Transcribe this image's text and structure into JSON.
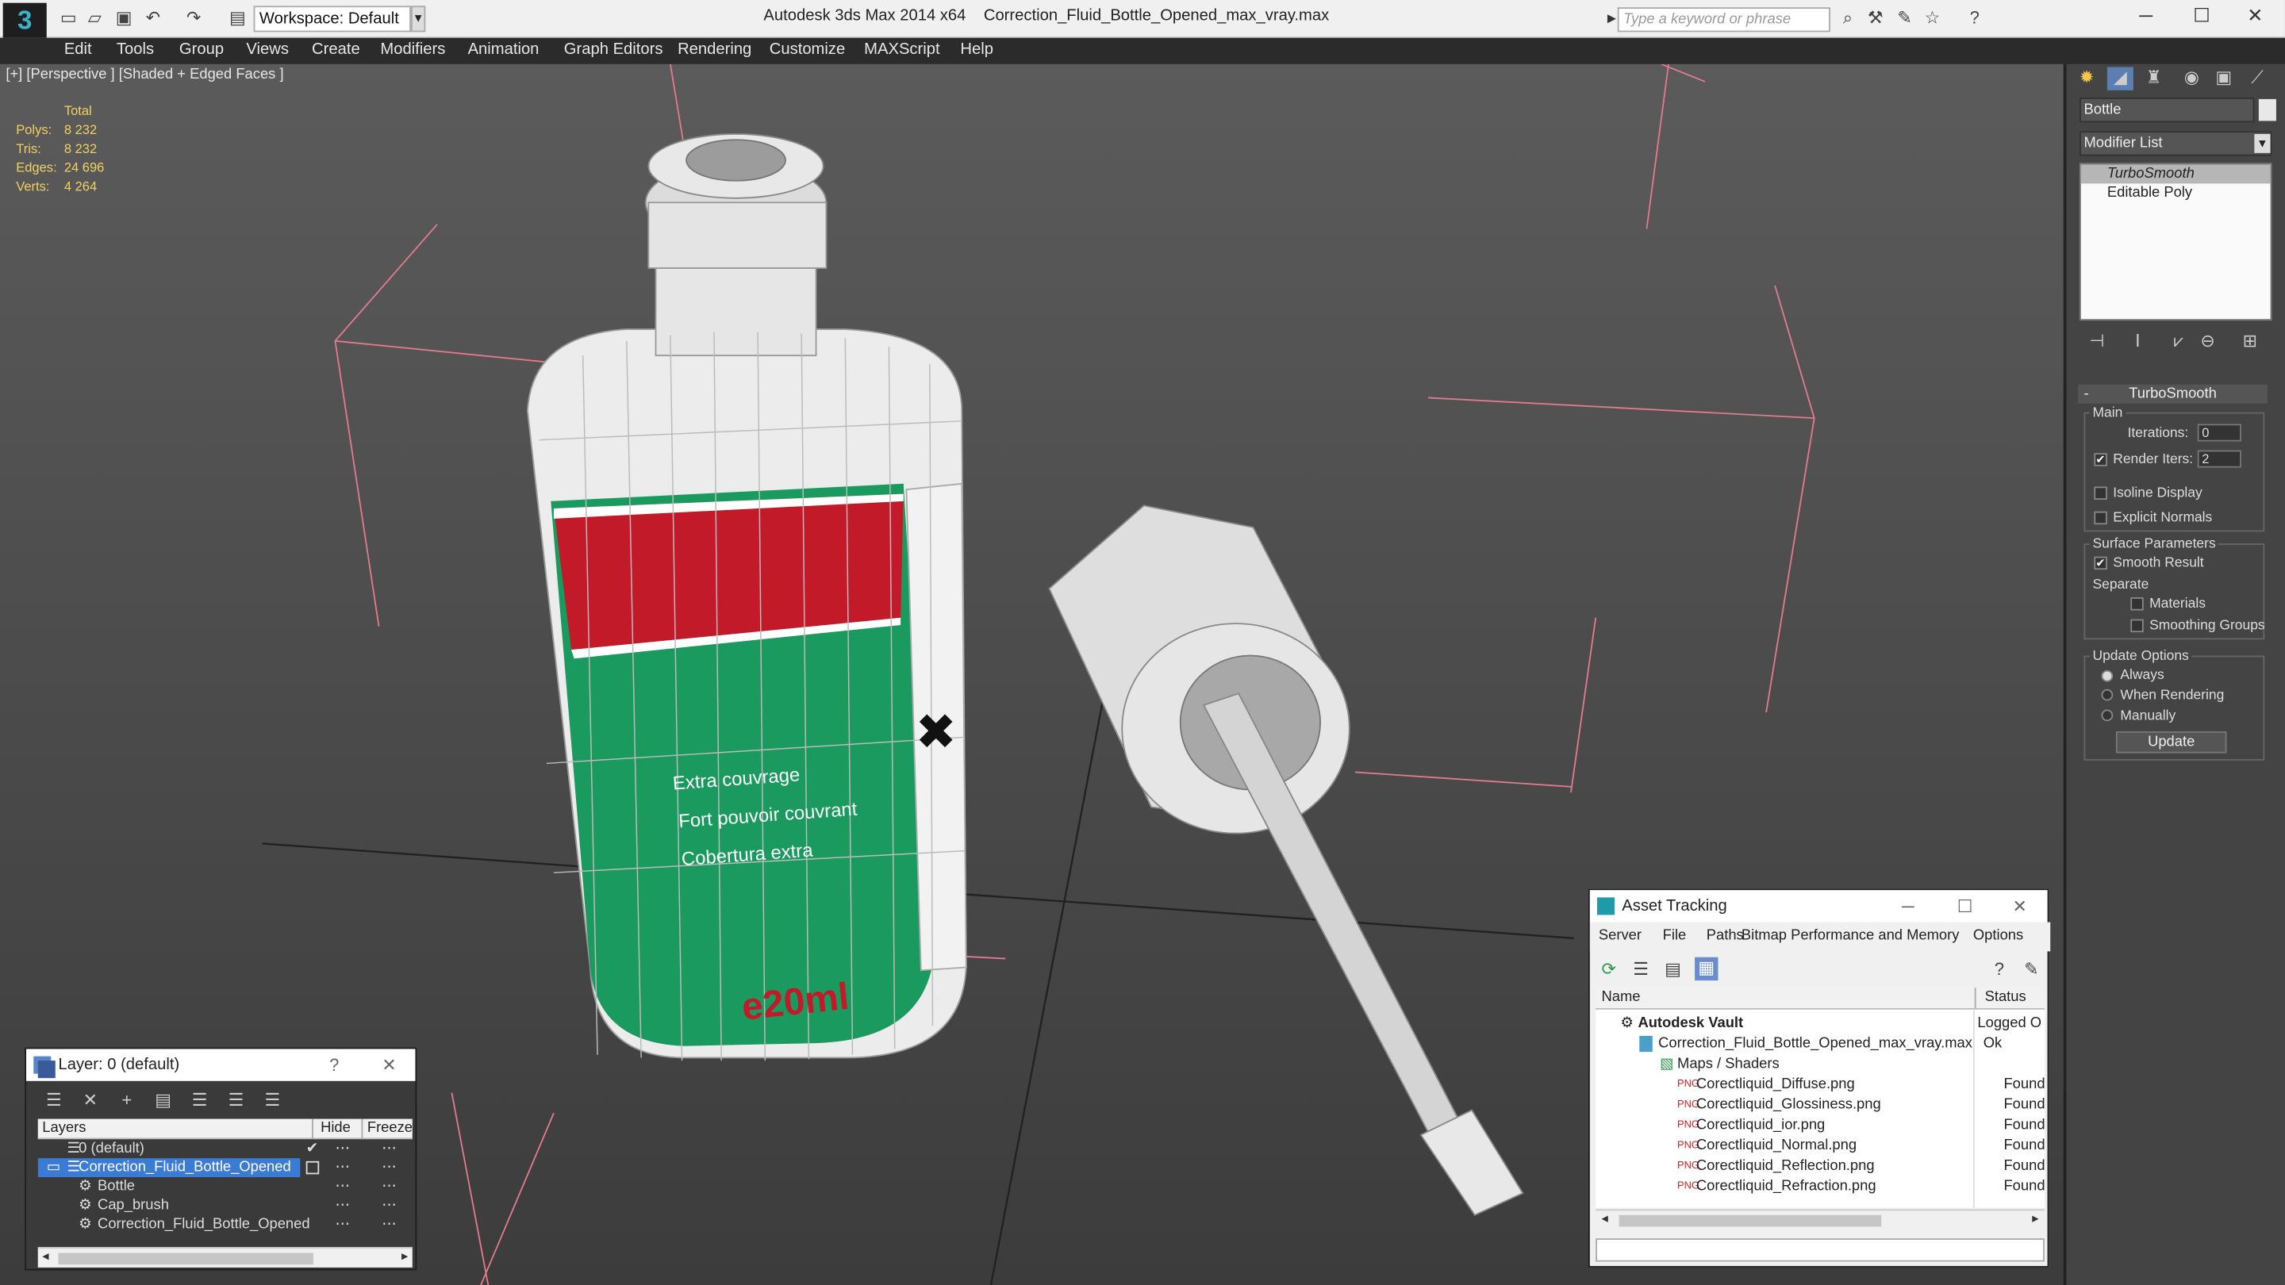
{
  "app": {
    "title": "Autodesk 3ds Max 2014 x64",
    "filename": "Correction_Fluid_Bottle_Opened_max_vray.max",
    "workspace": "Workspace: Default",
    "search_placeholder": "Type a keyword or phrase",
    "logo": "3"
  },
  "menu": [
    "Edit",
    "Tools",
    "Group",
    "Views",
    "Create",
    "Modifiers",
    "Animation",
    "Graph Editors",
    "Rendering",
    "Customize",
    "MAXScript",
    "Help"
  ],
  "viewport": {
    "label": "[+] [Perspective ] [Shaded + Edged Faces ]",
    "stats": {
      "header": "Total",
      "rows": [
        {
          "label": "Polys:",
          "value": "8 232"
        },
        {
          "label": "Tris:",
          "value": "8 232"
        },
        {
          "label": "Edges:",
          "value": "24 696"
        },
        {
          "label": "Verts:",
          "value": "4 264"
        }
      ]
    },
    "bottle_text": {
      "line1": "Extra couvrage",
      "line2": "Fort pouvoir couvrant",
      "line3": "Cobertura extra",
      "volume": "e20ml"
    }
  },
  "command_panel": {
    "object_name": "Bottle",
    "modifier_list": "Modifier List",
    "stack": [
      "TurboSmooth",
      "Editable Poly"
    ],
    "rollout_title": "TurboSmooth",
    "main_group": "Main",
    "iterations_label": "Iterations:",
    "iterations_value": "0",
    "render_iters_label": "Render Iters:",
    "render_iters_value": "2",
    "isoline": "Isoline Display",
    "explicit_normals": "Explicit Normals",
    "surface_params": "Surface Parameters",
    "smooth_result": "Smooth Result",
    "separate": "Separate",
    "materials": "Materials",
    "smoothing_groups": "Smoothing Groups",
    "update_options": "Update Options",
    "always": "Always",
    "when_rendering": "When Rendering",
    "manually": "Manually",
    "update_button": "Update"
  },
  "layer_window": {
    "title": "Layer: 0 (default)",
    "help": "?",
    "col_layers": "Layers",
    "col_hide": "Hide",
    "col_freeze": "Freeze",
    "rows": [
      {
        "name": "0 (default)",
        "indent": 1,
        "selected": false
      },
      {
        "name": "Correction_Fluid_Bottle_Opened",
        "indent": 1,
        "selected": true
      },
      {
        "name": "Bottle",
        "indent": 2,
        "selected": false
      },
      {
        "name": "Cap_brush",
        "indent": 2,
        "selected": false
      },
      {
        "name": "Correction_Fluid_Bottle_Opened",
        "indent": 2,
        "selected": false
      }
    ]
  },
  "asset_window": {
    "title": "Asset Tracking",
    "menu": [
      "Server",
      "File",
      "Paths",
      "Bitmap Performance and Memory",
      "Options"
    ],
    "col_name": "Name",
    "col_status": "Status",
    "rows": [
      {
        "name": "Autodesk Vault",
        "status": "Logged O",
        "indent": 1
      },
      {
        "name": "Correction_Fluid_Bottle_Opened_max_vray.max",
        "status": "Ok",
        "indent": 2
      },
      {
        "name": "Maps / Shaders",
        "status": "",
        "indent": 3
      },
      {
        "name": "Corectliquid_Diffuse.png",
        "status": "Found",
        "indent": 4
      },
      {
        "name": "Corectliquid_Glossiness.png",
        "status": "Found",
        "indent": 4
      },
      {
        "name": "Corectliquid_ior.png",
        "status": "Found",
        "indent": 4
      },
      {
        "name": "Corectliquid_Normal.png",
        "status": "Found",
        "indent": 4
      },
      {
        "name": "Corectliquid_Reflection.png",
        "status": "Found",
        "indent": 4
      },
      {
        "name": "Corectliquid_Refraction.png",
        "status": "Found",
        "indent": 4
      }
    ]
  },
  "colors": {
    "menubar": "#2b2b2b",
    "viewport": "#4a4a4a",
    "label_green": "#1a9a5e",
    "label_red": "#c21a28",
    "stats_yellow": "#f0d060",
    "selection_blue": "#3a7bd5"
  }
}
